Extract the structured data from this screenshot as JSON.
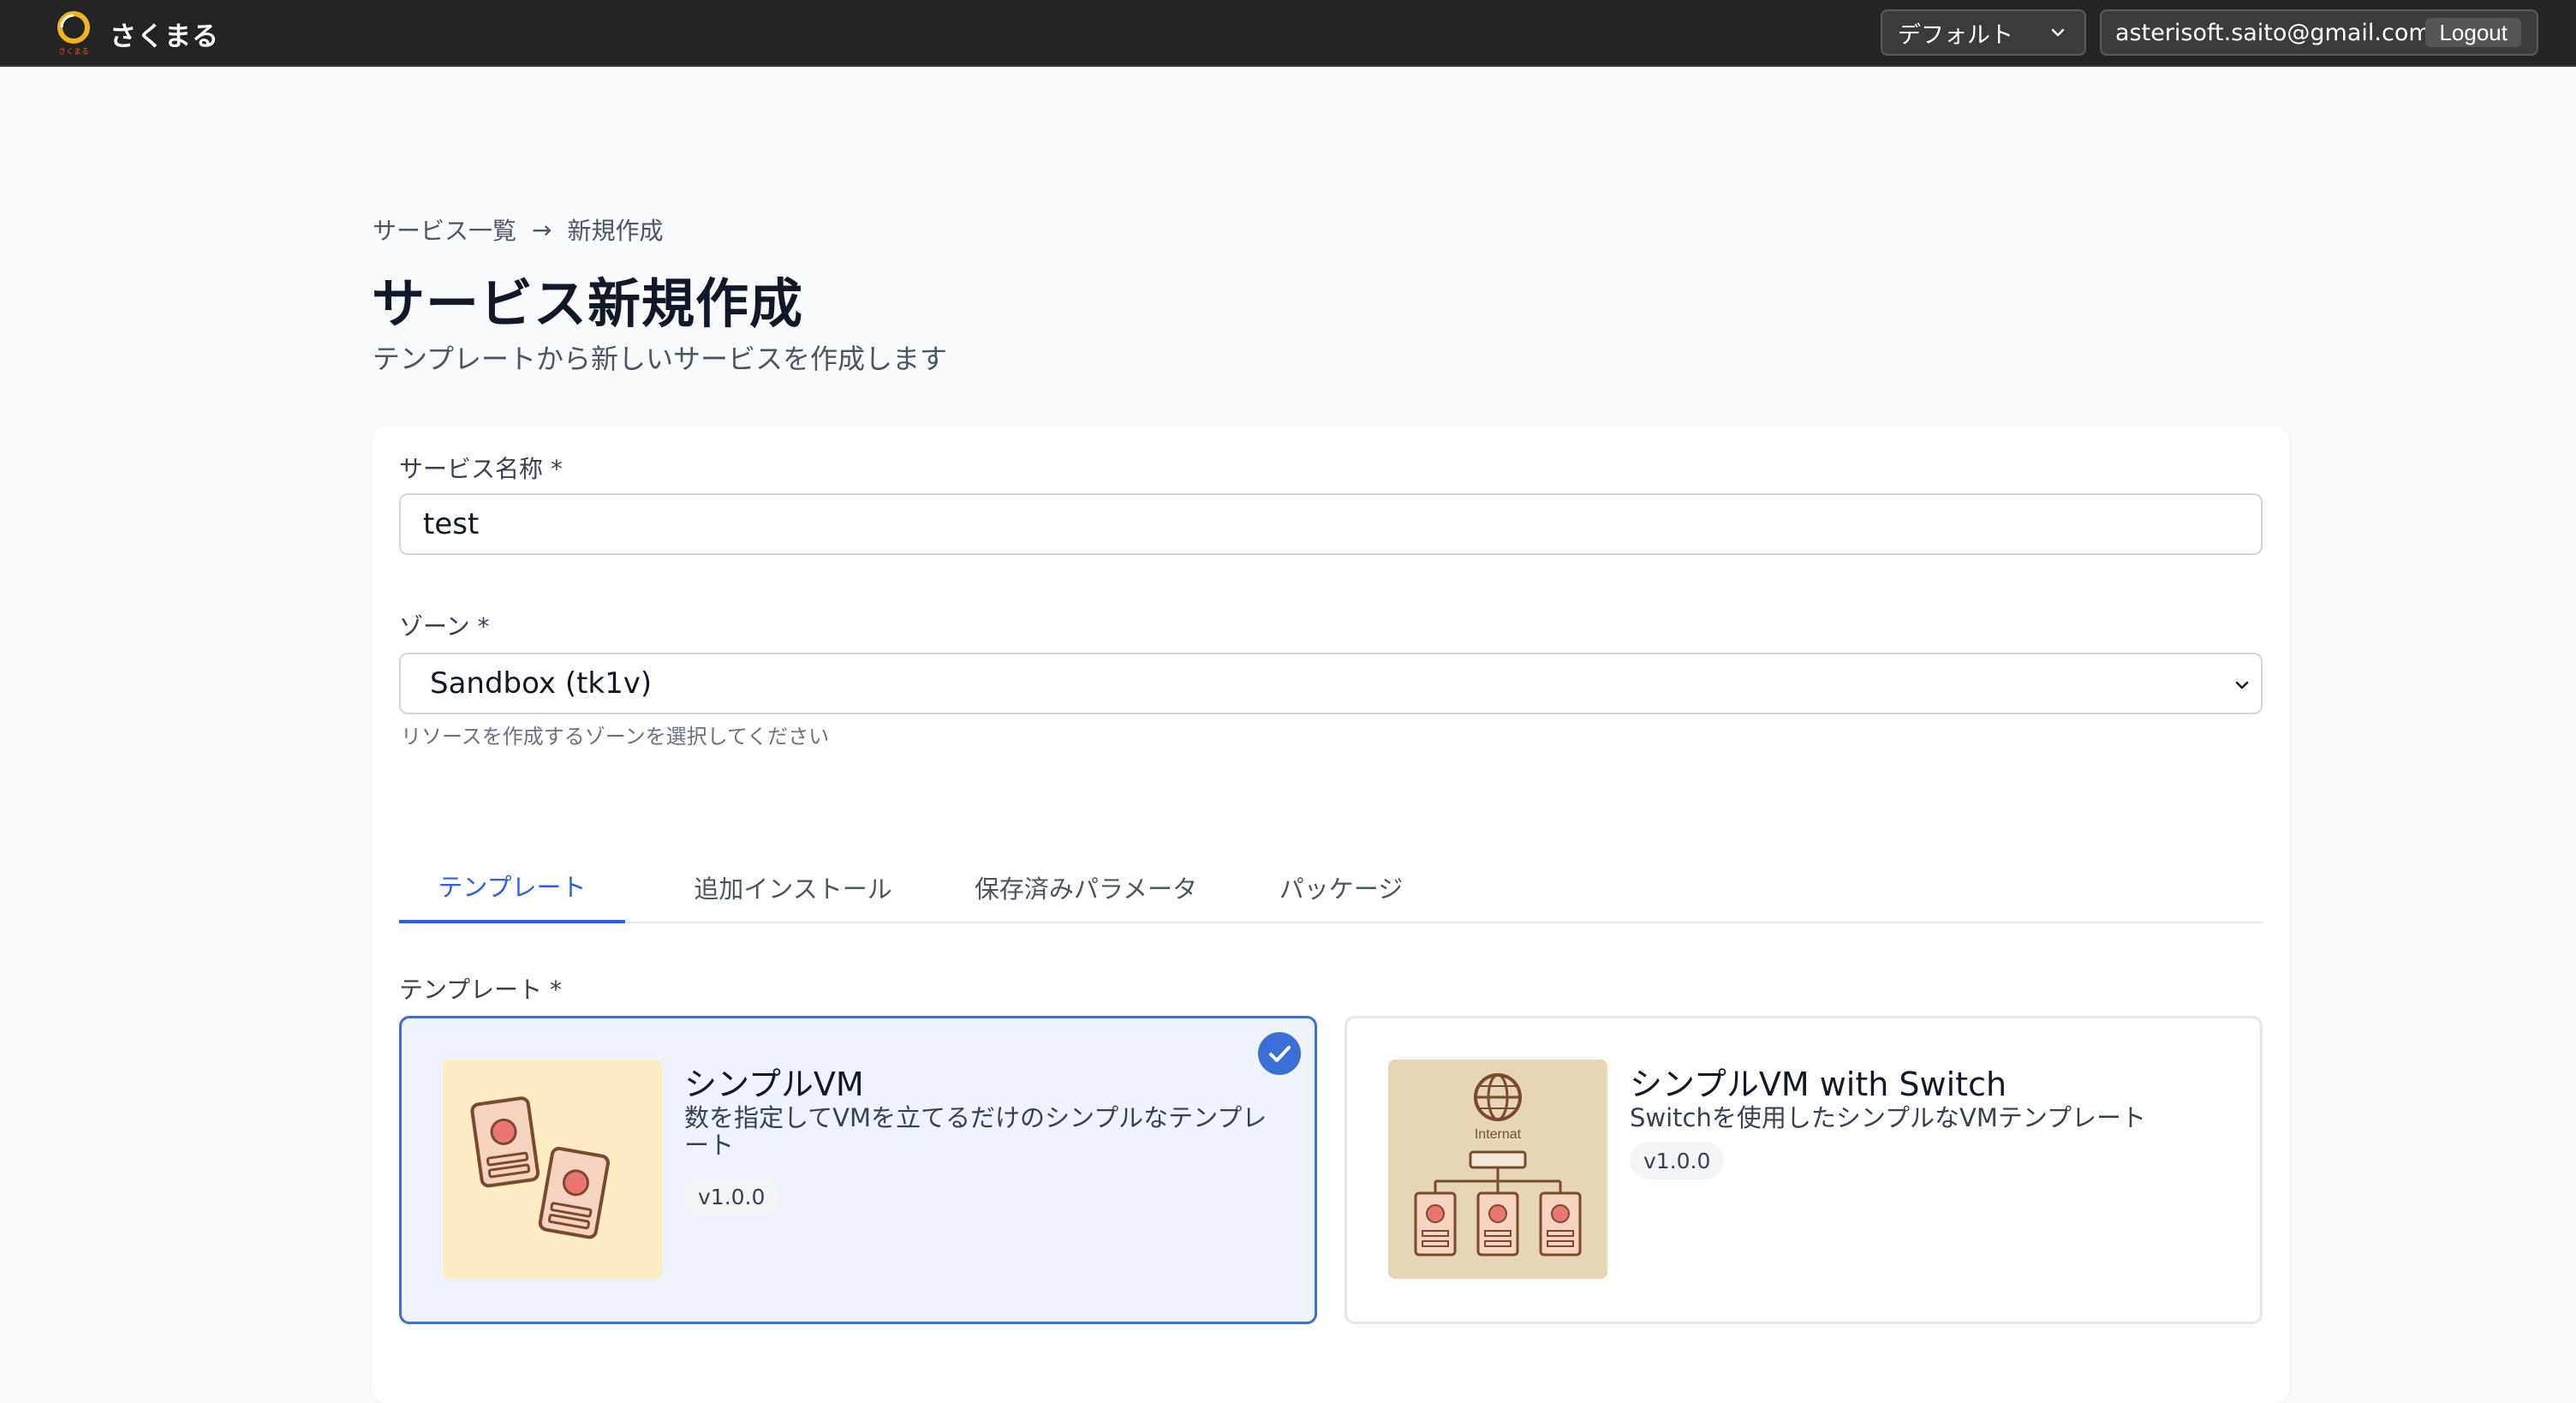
{
  "topbar": {
    "brand_name": "さくまる",
    "brand_logo_text": "さくまる",
    "environment_select": {
      "selected": "デフォルト"
    },
    "account": {
      "email": "asterisoft.saito@gmail.com",
      "logout_label": "Logout"
    }
  },
  "breadcrumb": {
    "items": [
      "サービス一覧",
      "新規作成"
    ],
    "separator": "→"
  },
  "page": {
    "title": "サービス新規作成",
    "subtitle": "テンプレートから新しいサービスを作成します"
  },
  "form": {
    "service_name": {
      "label": "サービス名称 *",
      "value": "test"
    },
    "zone": {
      "label": "ゾーン *",
      "selected": "Sandbox (tk1v)",
      "helper": "リソースを作成するゾーンを選択してください"
    }
  },
  "tabs": [
    {
      "label": "テンプレート",
      "active": true
    },
    {
      "label": "追加インストール",
      "active": false
    },
    {
      "label": "保存済みパラメータ",
      "active": false
    },
    {
      "label": "パッケージ",
      "active": false
    }
  ],
  "templates": {
    "label": "テンプレート *",
    "items": [
      {
        "name": "シンプルVM",
        "description": "数を指定してVMを立てるだけのシンプルなテンプレート",
        "version": "v1.0.0",
        "selected": true,
        "icon": "server-cards-icon"
      },
      {
        "name": "シンプルVM with Switch",
        "description": "Switchを使用したシンプルなVMテンプレート",
        "version": "v1.0.0",
        "selected": false,
        "icon": "network-switch-icon",
        "thumb_text": "Internat"
      }
    ]
  },
  "colors": {
    "accent": "#2563eb",
    "selected_border": "#3b6fd8",
    "topbar_bg": "#242424"
  }
}
